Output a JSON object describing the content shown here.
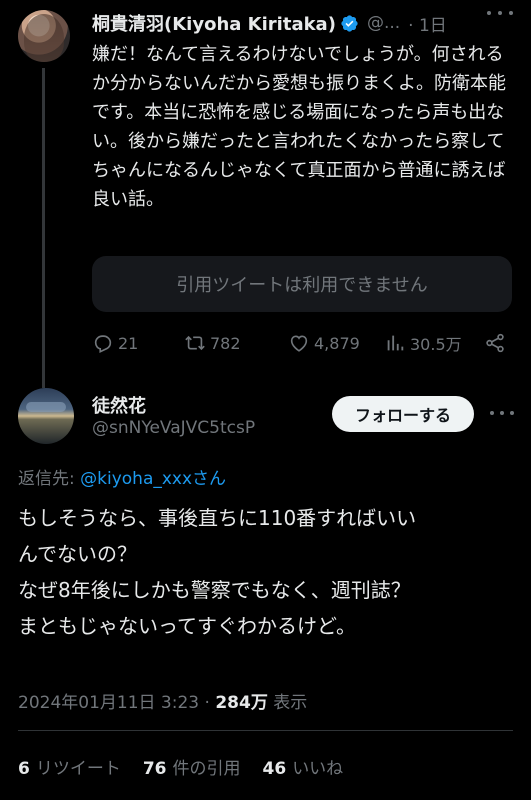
{
  "tweet1": {
    "author_name": "桐貴清羽(Kiyoha Kiritaka)",
    "handle": "@...",
    "time": "· 1日",
    "body": "嫌だ！なんて言えるわけないでしょうが。何されるか分からないんだから愛想も振りまくよ。防衛本能です。本当に恐怖を感じる場面になったら声も出ない。後から嫌だったと言われたくなかったら察してちゃんになるんじゃなくて真正面から普通に誘えば良い話。",
    "quote_unavailable": "引用ツイートは利用できません",
    "reply_count": "21",
    "retweet_count": "782",
    "like_count": "4,879",
    "view_count": "30.5万",
    "verified_color": "#1d9bf0"
  },
  "tweet2": {
    "author_name": "徒然花",
    "handle": "@snNYeVaJVC5tcsP",
    "follow_label": "フォローする",
    "reply_to_prefix": "返信先: ",
    "reply_to_mention": "@kiyoha_xxxさん",
    "body_lines": [
      "もしそうなら、事後直ちに110番すればいい",
      "んでないの？",
      "なぜ8年後にしかも警察でもなく、週刊誌？",
      "まともじゃないってすぐわかるけど。"
    ],
    "timestamp": "2024年01月11日 3:23 · ",
    "views_value": "284万",
    "views_label": " 表示",
    "retweets_value": "6",
    "retweets_label": "リツイート",
    "quotes_value": "76",
    "quotes_label": "件の引用",
    "likes_value": "46",
    "likes_label": "いいね"
  },
  "icons": [
    "verified-badge-icon",
    "more-icon",
    "reply-icon",
    "retweet-icon",
    "like-icon",
    "views-icon",
    "share-icon"
  ],
  "colors": {
    "background": "#000000",
    "text": "#e7e9ea",
    "muted": "#71767b",
    "link": "#1d9bf0"
  }
}
